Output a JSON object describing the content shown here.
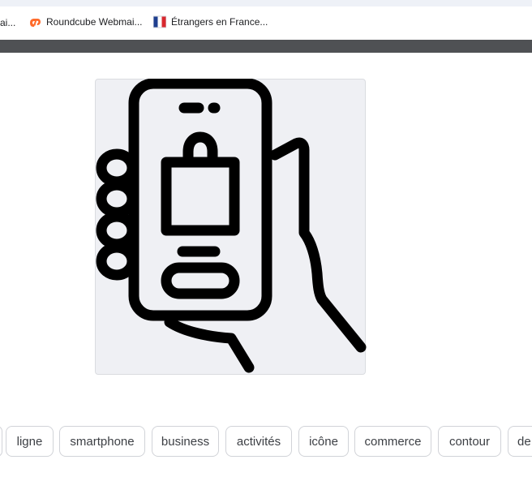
{
  "bookmarks": [
    {
      "label": "ai...",
      "icon": "folder-icon"
    },
    {
      "label": "Roundcube Webmai...",
      "icon": "cpanel-icon"
    },
    {
      "label": "Étrangers en France...",
      "icon": "french-flag-icon"
    }
  ],
  "image": {
    "alt_icon": "phone-shopping-bag-icon"
  },
  "tags": [
    "",
    "ligne",
    "smartphone",
    "business",
    "activités",
    "icône",
    "commerce",
    "contour",
    "de"
  ],
  "colors": {
    "card_bg": "#eff0f4",
    "cpanel_orange": "#ff6c2c",
    "flag_blue": "#1f3f8f",
    "flag_red": "#d8282f"
  }
}
